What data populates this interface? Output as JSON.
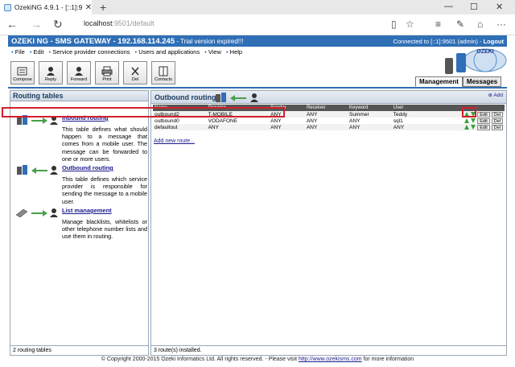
{
  "browser": {
    "tab_title": "OzekiNG 4.9.1 - [::1]:9501",
    "close_glyph": "✕",
    "new_tab_glyph": "+",
    "address_host": "localhost",
    "address_rest": ":9501/default",
    "min_glyph": "—",
    "max_glyph": "☐",
    "winclose_glyph": "✕",
    "back_glyph": "←",
    "forward_glyph": "→",
    "refresh_glyph": "↻",
    "reading_glyph": "▯",
    "favorite_glyph": "☆",
    "hub_glyph": "≡",
    "note_glyph": "✎",
    "share_glyph": "⌂",
    "more_glyph": "···"
  },
  "app": {
    "title": "OZEKI NG - SMS GATEWAY - 192.168.114.245",
    "trial": " - Trial version expired!!!",
    "connected": "Connected to [::1]:9501 (admin) - ",
    "logout": "Logout"
  },
  "menu": [
    "File",
    "Edit",
    "Service provider connections",
    "Users and applications",
    "View",
    "Help"
  ],
  "toolbar": [
    "Compose",
    "Reply",
    "Forward",
    "Print",
    "Del",
    "Contacts"
  ],
  "logo_text": "OZEKI",
  "view_tabs": [
    "Management",
    "Messages"
  ],
  "left": {
    "title": "Routing tables",
    "items": [
      {
        "link": "Inbound routing",
        "desc": "This table defines what should happen to a message that comes from a mobile user. The message can be forwarded to one or more users."
      },
      {
        "link": "Outbound routing",
        "desc": "This table defines which service provider is responsible for sending the message to a mobile user."
      },
      {
        "link": "List management",
        "desc": "Manage blacklists, whitelists or other telephone number lists and use them in routing."
      }
    ],
    "footer": "2 routing tables"
  },
  "right": {
    "title": "Outbound routing",
    "add": "Add",
    "columns": [
      "Name",
      "Provider",
      "Sender",
      "Receiver",
      "Keyword",
      "User"
    ],
    "rows": [
      {
        "name": "outbound2",
        "provider": "T-MOBILE",
        "sender": "ANY",
        "receiver": "ANY",
        "keyword": "Summer",
        "user": "Teddy"
      },
      {
        "name": "outbound0",
        "provider": "VODAFONE",
        "sender": "ANY",
        "receiver": "ANY",
        "keyword": "ANY",
        "user": "sql1"
      },
      {
        "name": "defaultout",
        "provider": "ANY",
        "sender": "ANY",
        "receiver": "ANY",
        "keyword": "ANY",
        "user": "ANY"
      }
    ],
    "edit": "Edit",
    "del": "Del",
    "add_route": "Add new route...",
    "footer": "3 route(s) installed."
  },
  "copyright": {
    "text": "© Copyright 2000-2015 Ozeki Informatics Ltd. All rights reserved. - Please visit ",
    "link": "http://www.ozekisms.com",
    "after": " for more information"
  }
}
